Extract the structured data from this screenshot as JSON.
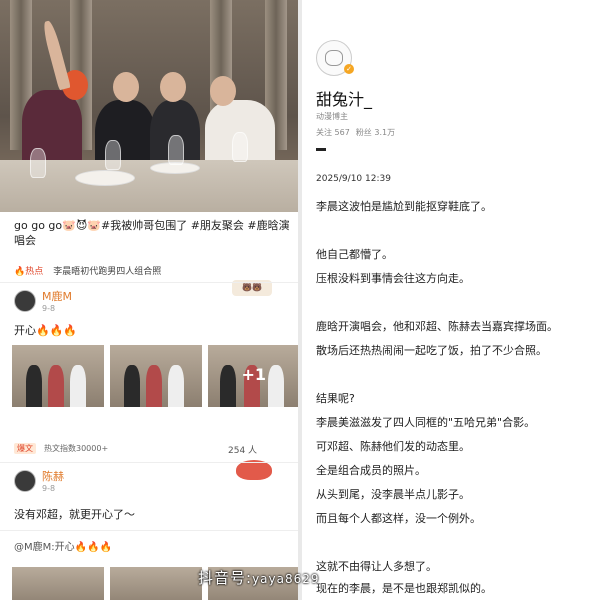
{
  "left": {
    "post_text": "go go go🐷😈🐷#我被帅哥包围了 #朋友聚会 #鹿晗演唱会",
    "hot_label": "🔥热点",
    "hot_topic": "李晨晤初代跑男四人组合照",
    "user1": {
      "name": "M鹿M",
      "date": "9-8",
      "comment": "开心🔥🔥🔥"
    },
    "stats": {
      "badge": "爆文",
      "heat": "热文指数30000+",
      "count": "254 人"
    },
    "user2": {
      "name": "陈赫",
      "date": "9-8",
      "comment": "没有邓超，就更开心了～"
    },
    "quote": "@M鹿M:开心🔥🔥🔥",
    "thumb_plus": "+1"
  },
  "right": {
    "name": "甜兔汁_",
    "subtitle": "动漫博主",
    "follow": "关注 567",
    "fans": "粉丝 3.1万",
    "date": "2025/9/10 12:39",
    "lines": [
      "李晨这波怕是尴尬到能抠穿鞋底了。",
      "他自己都懵了。",
      "压根没料到事情会往这方向走。",
      "鹿晗开演唱会，他和邓超、陈赫去当嘉宾撑场面。",
      "散场后还热热闹闹一起吃了饭，拍了不少合照。",
      "结果呢?",
      "李晨美滋滋发了四人同框的\"五哈兄弟\"合影。",
      "可邓超、陈赫他们发的动态里。",
      "全是组合成员的照片。",
      "从头到尾，没李晨半点儿影子。",
      "而且每个人都这样，没一个例外。",
      "这就不由得让人多想了。",
      "现在的李晨，是不是也跟郑凯似的。"
    ]
  },
  "watermark": {
    "label": "抖音号:",
    "id": "yaya8629"
  }
}
